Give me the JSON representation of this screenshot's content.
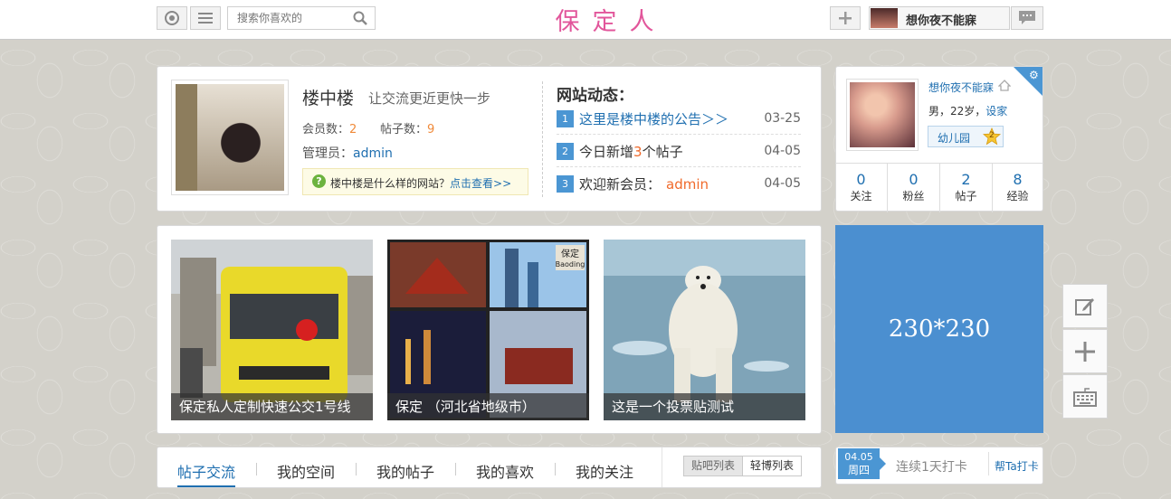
{
  "topbar": {
    "search_placeholder": "搜索你喜欢的",
    "site_title": "保定人",
    "username": "想你夜不能寐",
    "icons": [
      "circle-icon",
      "menu-icon",
      "search-icon",
      "plus-icon",
      "message-icon"
    ]
  },
  "forum": {
    "name": "楼中楼",
    "slogan": "让交流更近更快一步",
    "members_label": "会员数：",
    "members_count": "2",
    "posts_label": "帖子数：",
    "posts_count": "9",
    "admin_label": "管理员：",
    "admin_name": "admin",
    "help_text": "楼中楼是什么样的网站？",
    "help_link": "点击查看>>"
  },
  "news": {
    "title": "网站动态：",
    "items": [
      {
        "num": "1",
        "text": "这里是楼中楼的公告＞＞",
        "date": "03-25"
      },
      {
        "num": "2",
        "text_prefix": "今日新增",
        "highlight": "3",
        "text_suffix": "个帖子",
        "date": "04-05"
      },
      {
        "num": "3",
        "text_prefix": "欢迎新会员：",
        "highlight": "admin",
        "date": "04-05"
      }
    ]
  },
  "profile": {
    "name": "想你夜不能寐",
    "info_prefix": "男，22岁，",
    "info_link": "设家",
    "level": "幼儿园",
    "level_num": "2",
    "stats": [
      {
        "value": "0",
        "label": "关注"
      },
      {
        "value": "0",
        "label": "粉丝"
      },
      {
        "value": "2",
        "label": "帖子"
      },
      {
        "value": "8",
        "label": "经验"
      }
    ]
  },
  "featured": [
    {
      "caption": "保定私人定制快速公交1号线"
    },
    {
      "caption": "保定 （河北省地级市）",
      "tag": "保定",
      "tag_sub": "Baoding"
    },
    {
      "caption": "这是一个投票贴测试"
    }
  ],
  "ad": {
    "text": "230*230"
  },
  "tabs": [
    "帖子交流",
    "我的空间",
    "我的帖子",
    "我的喜欢",
    "我的关注"
  ],
  "view_toggle": [
    "贴吧列表",
    "轻博列表"
  ],
  "checkin": {
    "date": "04.05",
    "weekday": "周四",
    "streak": "连续1天打卡",
    "button": "帮Ta打卡"
  }
}
